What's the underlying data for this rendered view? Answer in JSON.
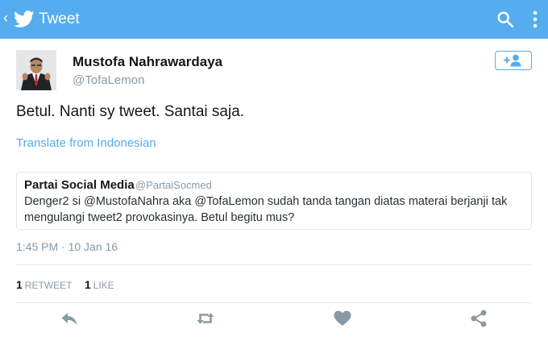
{
  "app_bar": {
    "title": "Tweet",
    "back_icon": "chevron-left-icon",
    "logo_icon": "twitter-bird-icon",
    "search_icon": "search-icon",
    "more_icon": "more-vertical-icon"
  },
  "colors": {
    "brand": "#55acee",
    "text_primary": "#14171a",
    "text_secondary": "#8899a6",
    "divider": "#e1e8ed"
  },
  "tweet": {
    "author_name": "Mustofa Nahrawardaya",
    "author_handle": "@TofaLemon",
    "text": "Betul. Nanti sy tweet. Santai saja.",
    "translate_link": "Translate from Indonesian",
    "timestamp": "1:45 PM · 10 Jan 16"
  },
  "quoted_tweet": {
    "author_name": "Partai Social Media",
    "author_handle": "@PartaiSocmed",
    "text": "Denger2 si @MustofaNahra aka @TofaLemon sudah tanda tangan diatas materai berjanji tak mengulangi tweet2 provokasinya. Betul begitu mus?"
  },
  "stats": {
    "retweets": {
      "count": "1",
      "label": "RETWEET"
    },
    "likes": {
      "count": "1",
      "label": "LIKE"
    }
  },
  "actions": [
    "reply-icon",
    "retweet-icon",
    "heart-icon",
    "share-icon"
  ]
}
